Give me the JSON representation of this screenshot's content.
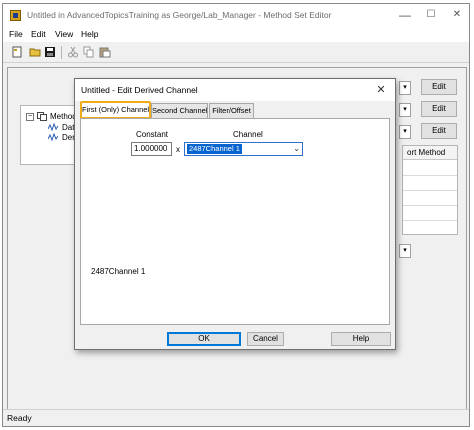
{
  "window": {
    "title": "Untitled in AdvancedTopicsTraining as George/Lab_Manager - Method Set Editor",
    "minimize": "—",
    "maximize": "☐",
    "close": "✕"
  },
  "menu": [
    "File",
    "Edit",
    "View",
    "Help"
  ],
  "toolbar": {
    "icons": [
      "new-icon",
      "open-icon",
      "save-icon",
      "cut-icon",
      "copy-icon",
      "paste-icon"
    ]
  },
  "tree": {
    "root_label": "Method S",
    "children": [
      "Data",
      "Deriv"
    ]
  },
  "background": {
    "edit_label": "Edit",
    "grid_header": "ort Method"
  },
  "status": {
    "text": "Ready"
  },
  "dialog": {
    "title": "Untitled - Edit Derived Channel",
    "close": "✕",
    "tabs": [
      {
        "label": "First (Only) Channel",
        "active": true
      },
      {
        "label": "Second Channel",
        "active": false
      },
      {
        "label": "Filter/Offset",
        "active": false
      }
    ],
    "constant_label": "Constant",
    "channel_label": "Channel",
    "constant_value": "1.000000",
    "multiply_sign": "x",
    "channel_value": "2487Channel 1",
    "summary": "2487Channel 1",
    "buttons": {
      "ok": "OK",
      "cancel": "Cancel",
      "help": "Help"
    }
  },
  "colors": {
    "tab_highlight": "#f0ab1a",
    "selection": "#0a64d0",
    "focus_border": "#2f6fcf"
  }
}
